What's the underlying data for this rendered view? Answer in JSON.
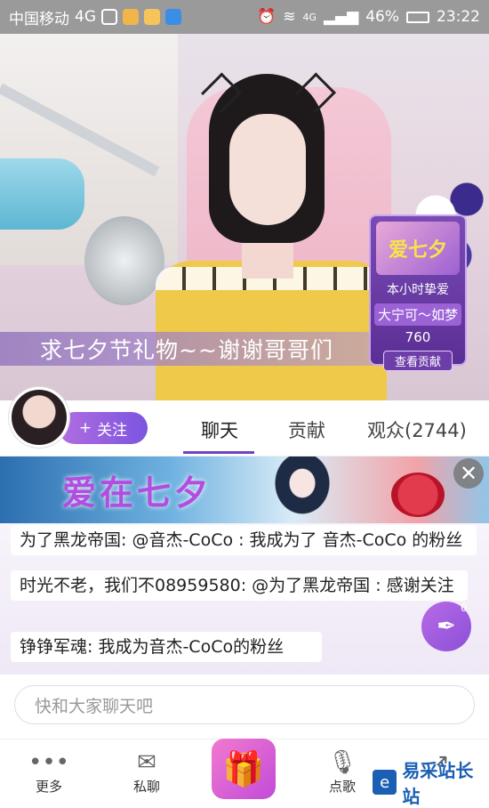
{
  "status_bar": {
    "carrier": "中国移动",
    "network": "4G",
    "battery": "46%",
    "time": "23:22",
    "signal_label": "4G"
  },
  "stream": {
    "banner_text": "求七夕节礼物~~谢谢哥哥们",
    "gift_card": {
      "logo_text": "爱七夕",
      "line1": "本小时挚爱",
      "line2": "大宁可～如梦",
      "value": "760",
      "button": "查看贡献"
    }
  },
  "info_bar": {
    "follow_label": "关注",
    "tabs": [
      {
        "label": "聊天",
        "active": true
      },
      {
        "label": "贡献",
        "active": false
      },
      {
        "label": "观众(2744)",
        "active": false
      }
    ]
  },
  "ad": {
    "title": "爱在七夕"
  },
  "chat": {
    "messages": [
      {
        "text": "为了黑龙帝国: @音杰-CoCo : 我成为了 音杰-CoCo 的粉丝"
      },
      {
        "text": "时光不老，我们不08959580: @为了黑龙帝国 : 感谢关注"
      },
      {
        "text": "铮铮军魂: 我成为音杰-CoCo的粉丝"
      }
    ],
    "feather_count": "0"
  },
  "input": {
    "placeholder": "快和大家聊天吧"
  },
  "bottom_nav": {
    "more": "更多",
    "private_chat": "私聊",
    "song_request": "点歌"
  },
  "watermark": {
    "text": "易采站长站"
  }
}
